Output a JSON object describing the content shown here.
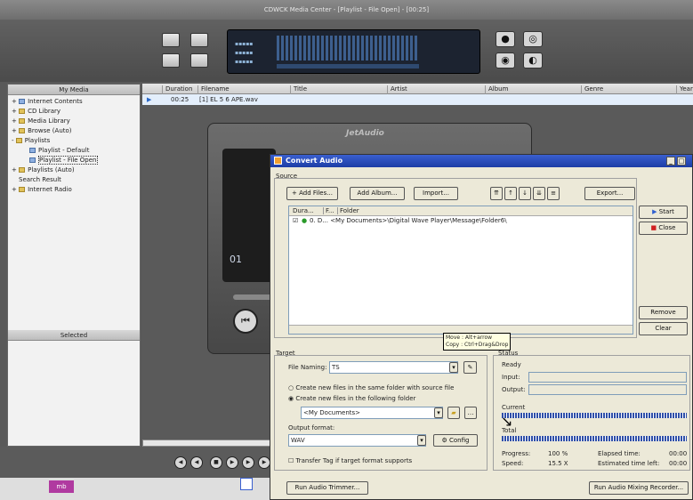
{
  "window": {
    "title": "CDWCK Media Center - [Playlist - File Open] - [00:25]"
  },
  "left_panel": {
    "title": "My Media",
    "tree": [
      {
        "label": "Internet Contents",
        "icon": "globe-icon"
      },
      {
        "label": "CD Library",
        "icon": "cd-icon"
      },
      {
        "label": "Media Library",
        "icon": "folder-icon"
      },
      {
        "label": "Browse (Auto)",
        "icon": "folder-icon"
      },
      {
        "label": "Playlists",
        "icon": "folder-icon"
      },
      {
        "label": "Playlist - Default",
        "icon": "playlist-icon"
      },
      {
        "label": "Playlist - File Open",
        "icon": "playlist-icon"
      },
      {
        "label": "Playlists (Auto)",
        "icon": "folder-icon"
      },
      {
        "label": "Search Result",
        "icon": "search-icon"
      },
      {
        "label": "Internet Radio",
        "icon": "radio-icon"
      }
    ],
    "selected_title": "Selected"
  },
  "list": {
    "columns": [
      "Duration",
      "Filename",
      "Title",
      "Artist",
      "Album",
      "Genre",
      "Year"
    ],
    "rows": [
      {
        "duration": "00:25",
        "filename": "[1] EL 5 6 APE.wav"
      }
    ]
  },
  "skin": {
    "logo": "JetAudio",
    "track": "01"
  },
  "dialog": {
    "title": "Convert Audio",
    "source_label": "Source",
    "add_files": "Add Files...",
    "add_album": "Add Album...",
    "import": "Import...",
    "export": "Export...",
    "col_dura": "Dura...",
    "col_f": "F...",
    "col_folder": "Folder",
    "file_row": "0. D...  <My Documents>\\Digital Wave Player\\Message\\Folder6\\",
    "start": "Start",
    "close": "Close",
    "remove": "Remove",
    "clear": "Clear",
    "tooltip_line1": "Move : Alt+arrow",
    "tooltip_line2": "Copy : Ctrl+Drag&Drop",
    "target_label": "Target",
    "file_naming_label": "File Naming:",
    "file_naming_value": "TS",
    "create_same": "Create new files in the same folder with source file",
    "create_following": "Create new files in the following folder",
    "folder_value": "<My Documents>",
    "output_format_label": "Output format:",
    "output_format_value": "WAV",
    "config": "Config",
    "transfer_tag": "Transfer Tag if target format supports",
    "status_label": "Status",
    "ready": "Ready",
    "input_label": "Input:",
    "output_label": "Output:",
    "current_label": "Current",
    "total_label": "Total",
    "progress_label": "Progress:",
    "progress_value": "100 %",
    "speed_label": "Speed:",
    "speed_value": "15.5 X",
    "elapsed_label": "Elapsed time:",
    "elapsed_value": "00:00",
    "estimated_label": "Estimated time left:",
    "estimated_value": "00:00",
    "run_trimmer": "Run Audio Trimmer...",
    "run_mixing": "Run Audio Mixing Recorder..."
  },
  "taskbar": {
    "item": "mb"
  },
  "colors": {
    "title_blue": "#1c3da6",
    "row_highlight": "#e3eefb",
    "lcd_bg": "#1c2330"
  }
}
